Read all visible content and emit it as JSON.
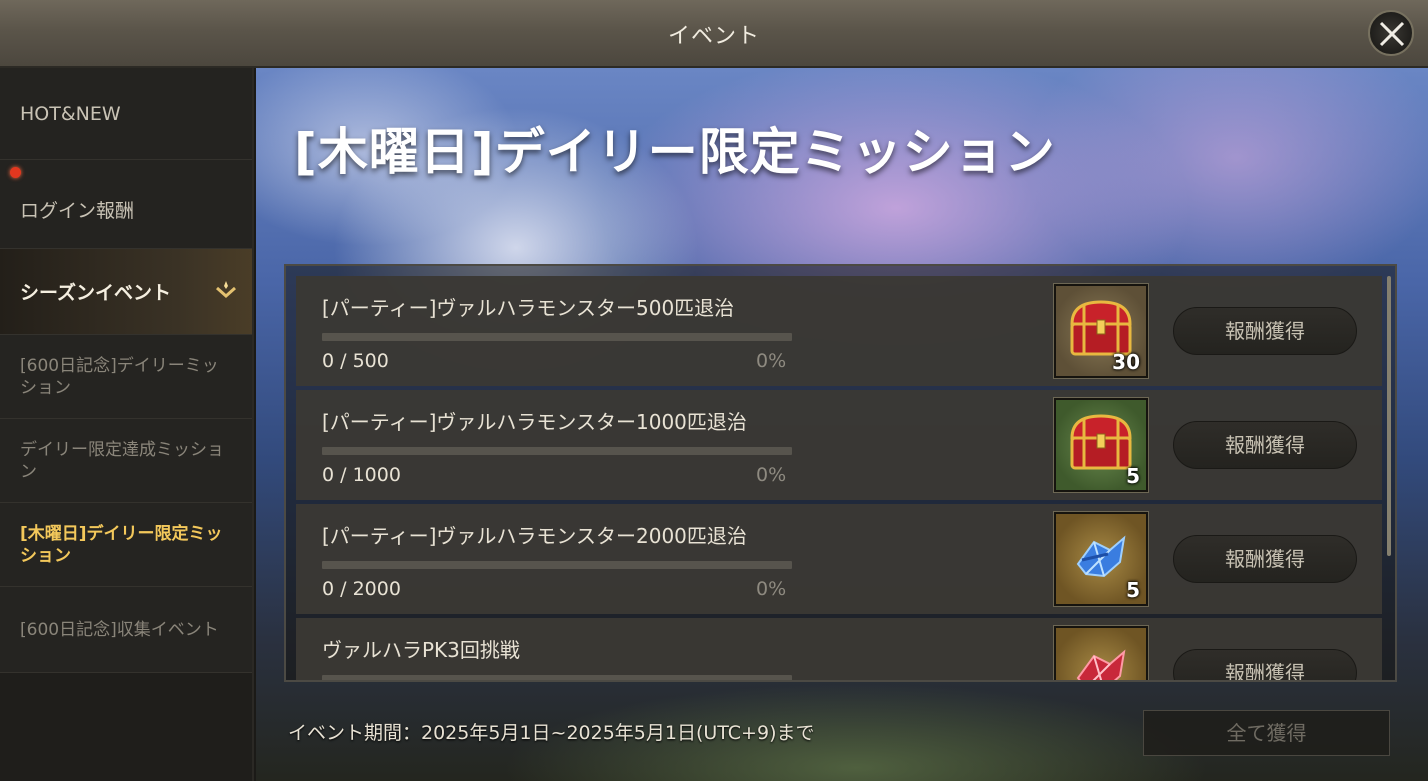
{
  "window": {
    "title": "イベント"
  },
  "sidebar": {
    "items": [
      {
        "label": "HOT&NEW"
      },
      {
        "label": "ログイン報酬",
        "has_notification": true
      },
      {
        "label": "シーズンイベント",
        "expanded": true
      },
      {
        "label": "[600日記念]デイリーミッション"
      },
      {
        "label": "デイリー限定達成ミッション"
      },
      {
        "label": "[木曜日]デイリー限定ミッション",
        "active": true
      },
      {
        "label": "[600日記念]収集イベント"
      }
    ]
  },
  "main": {
    "heading": "[木曜日]デイリー限定ミッション",
    "missions": [
      {
        "title": "[パーティー]ヴァルハラモンスター500匹退治",
        "count": "0 / 500",
        "percent": "0%",
        "progress": 0,
        "reward_icon": "treasure-chest-icon",
        "reward_qty": "30",
        "claim_label": "報酬獲得"
      },
      {
        "title": "[パーティー]ヴァルハラモンスター1000匹退治",
        "count": "0 / 1000",
        "percent": "0%",
        "progress": 0,
        "reward_icon": "treasure-chest-icon",
        "reward_qty": "5",
        "claim_label": "報酬獲得"
      },
      {
        "title": "[パーティー]ヴァルハラモンスター2000匹退治",
        "count": "0 / 2000",
        "percent": "0%",
        "progress": 0,
        "reward_icon": "blue-crystal-icon",
        "reward_qty": "5",
        "claim_label": "報酬獲得"
      },
      {
        "title": "ヴァルハラPK3回挑戦",
        "reward_icon": "red-crystal-icon",
        "claim_label": "報酬獲得"
      }
    ],
    "event_period": "イベント期間：2025年5月1日~2025年5月1日(UTC+9)まで",
    "collect_all_label": "全て獲得"
  },
  "colors": {
    "accent_gold": "#f3c85b",
    "notification_red": "#e2371f"
  }
}
